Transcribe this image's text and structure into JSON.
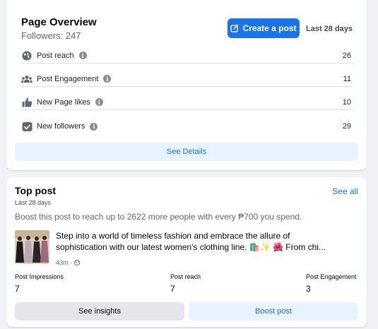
{
  "overview": {
    "title": "Page Overview",
    "followers": "Followers: 247",
    "create_post_label": "Create a post",
    "period": "Last 28 days",
    "metrics": [
      {
        "label": "Post reach",
        "value": "26",
        "icon": "globe-icon"
      },
      {
        "label": "Post Engagement",
        "value": "11",
        "icon": "people-icon"
      },
      {
        "label": "New Page likes",
        "value": "10",
        "icon": "thumbs-up-icon"
      },
      {
        "label": "New followers",
        "value": "29",
        "icon": "follow-icon"
      }
    ],
    "see_details_label": "See Details"
  },
  "top_post": {
    "title": "Top post",
    "see_all_label": "See all",
    "subtitle": "Last 28 days",
    "boost_text": "Boost this post to reach up to 2622 more people with every ₱700 you spend.",
    "post_line1": "Step into a world of timeless fashion and embrace the allure of",
    "post_line2": "sophistication with our latest women's clothing line. 🛍️✨ 🌺 From chi...",
    "post_time": "43m ·",
    "stats": [
      {
        "label": "Post Impressions",
        "value": "7"
      },
      {
        "label": "Post reach",
        "value": "7"
      },
      {
        "label": "Post Engagement",
        "value": "3"
      }
    ],
    "see_insights_label": "See insights",
    "boost_post_label": "Boost post"
  },
  "colors": {
    "accent": "#1b74e4",
    "page_bg": "#f0f2f5",
    "light_blue": "#e7f3ff"
  }
}
